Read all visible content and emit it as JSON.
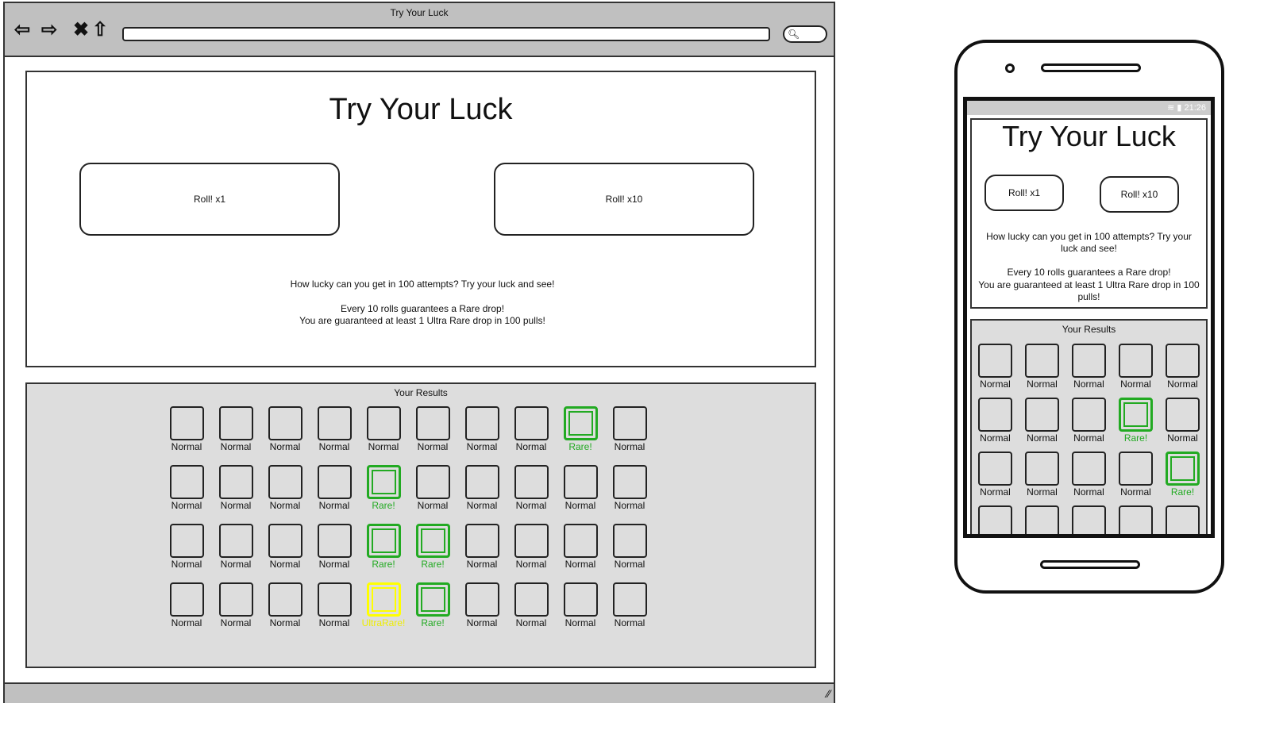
{
  "browser": {
    "title": "Try Your Luck",
    "nav_icons": [
      "back-icon",
      "forward-icon",
      "close-icon",
      "home-icon"
    ],
    "search_icon": "search-icon"
  },
  "page": {
    "title": "Try Your Luck",
    "roll1": "Roll! x1",
    "roll10": "Roll! x10",
    "intro": "How lucky can you get in 100 attempts? Try your luck and see!",
    "rule1": "Every 10 rolls guarantees a Rare drop!",
    "rule2": "You are guaranteed at least 1 Ultra Rare drop in 100 pulls!",
    "results_title": "Your Results"
  },
  "labels": {
    "normal": "Normal",
    "rare": "Rare!",
    "ultra": "UltraRare!"
  },
  "colors": {
    "rare": "#22aa22",
    "ultra": "#ffff00",
    "panel": "#dddddd"
  },
  "desktop_results": [
    [
      "normal",
      "normal",
      "normal",
      "normal",
      "normal",
      "normal",
      "normal",
      "normal",
      "rare",
      "normal"
    ],
    [
      "normal",
      "normal",
      "normal",
      "normal",
      "rare",
      "normal",
      "normal",
      "normal",
      "normal",
      "normal"
    ],
    [
      "normal",
      "normal",
      "normal",
      "normal",
      "rare",
      "rare",
      "normal",
      "normal",
      "normal",
      "normal"
    ],
    [
      "normal",
      "normal",
      "normal",
      "normal",
      "ultra",
      "rare",
      "normal",
      "normal",
      "normal",
      "normal"
    ]
  ],
  "mobile": {
    "time": "21:26",
    "title": "Try Your Luck",
    "roll1": "Roll! x1",
    "roll10": "Roll! x10",
    "intro": "How lucky can you get in 100 attempts? Try your luck and see!",
    "rule1": "Every 10 rolls guarantees a Rare drop!",
    "rule2": "You are guaranteed at least 1 Ultra Rare drop in 100 pulls!",
    "results_title": "Your Results",
    "results": [
      [
        "normal",
        "normal",
        "normal",
        "normal",
        "normal"
      ],
      [
        "normal",
        "normal",
        "normal",
        "rare",
        "normal"
      ],
      [
        "normal",
        "normal",
        "normal",
        "normal",
        "rare"
      ],
      [
        "normal",
        "normal",
        "normal",
        "normal",
        "normal"
      ]
    ]
  }
}
